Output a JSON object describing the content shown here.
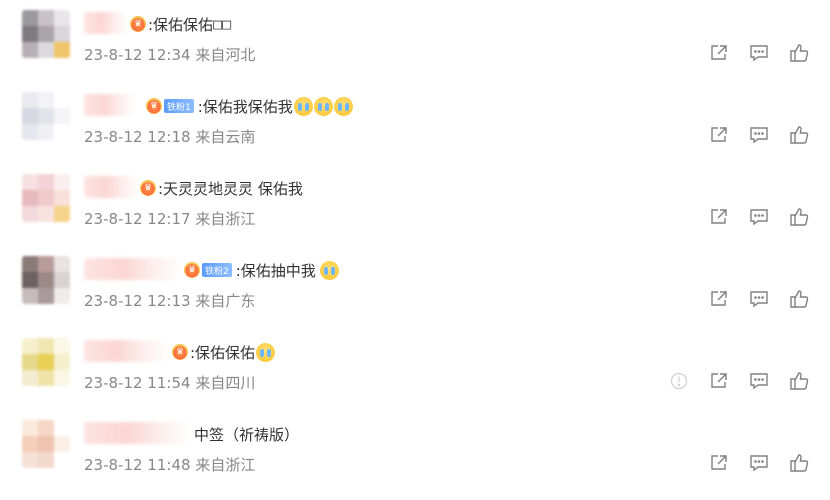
{
  "comments": [
    {
      "text": ":保佑保佑",
      "tail_boxes": "□□",
      "time": "23-8-12 12:34",
      "location_label": "来自",
      "location": "河北",
      "fan_badge": "",
      "emoji_count": 0
    },
    {
      "text": ":保佑我保佑我",
      "tail_boxes": "",
      "time": "23-8-12 12:18",
      "location_label": "来自",
      "location": "云南",
      "fan_badge": "铁粉1",
      "emoji_count": 3
    },
    {
      "text": ":天灵灵地灵灵 保佑我",
      "tail_boxes": "",
      "time": "23-8-12 12:17",
      "location_label": "来自",
      "location": "浙江",
      "fan_badge": "",
      "emoji_count": 0
    },
    {
      "text": ":保佑抽中我",
      "tail_boxes": "",
      "time": "23-8-12 12:13",
      "location_label": "来自",
      "location": "广东",
      "fan_badge": "铁粉2",
      "emoji_count": 1
    },
    {
      "text": ":保佑保佑",
      "tail_boxes": "",
      "time": "23-8-12 11:54",
      "location_label": "来自",
      "location": "四川",
      "fan_badge": "",
      "emoji_count": 1,
      "has_report": true
    },
    {
      "text": "中签（祈祷版）",
      "tail_boxes": "",
      "time": "23-8-12 11:48",
      "location_label": "来自",
      "location": "浙江",
      "fan_badge": "",
      "emoji_count": 0
    }
  ],
  "icons": {
    "share": "share-icon",
    "comment": "comment-icon",
    "like": "like-icon",
    "report": "report-icon"
  },
  "colors": {
    "meta_text": "#888888",
    "icon_stroke": "#808080",
    "fan_badge_bg": "#5b9cff"
  }
}
